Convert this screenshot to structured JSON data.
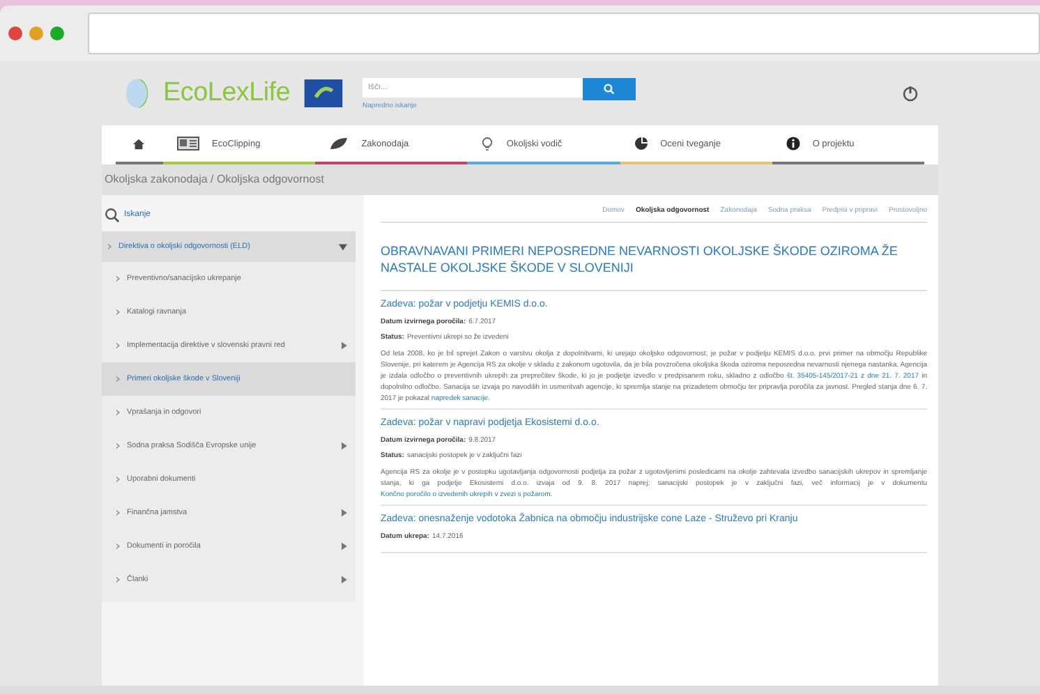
{
  "site": {
    "logo": "EcoLexLife",
    "search": {
      "placeholder": "Išči...",
      "advanced": "Napredno iskanje"
    }
  },
  "nav": [
    {
      "label": "EcoClipping",
      "color": "#a8c84a"
    },
    {
      "label": "Zakonodaja",
      "color": "#c0456a"
    },
    {
      "label": "Okoljski vodič",
      "color": "#5aa9d8"
    },
    {
      "label": "Oceni tveganje",
      "color": "#e8c07a"
    },
    {
      "label": "O projektu",
      "color": "#777777"
    }
  ],
  "breadcrumb": "Okoljska zakonodaja / Okoljska odgovornost",
  "sidebar": {
    "search_label": "Iskanje",
    "section": {
      "label": "Direktiva o okoljski odgovornosti (ELD)",
      "expanded": true
    },
    "items": [
      {
        "label": "Preventivno/sanacijsko ukrepanje",
        "selected": false,
        "has_children": false
      },
      {
        "label": "Katalogi ravnanja",
        "selected": false,
        "has_children": false
      },
      {
        "label": "Implementacija direktive v slovenski pravni red",
        "selected": false,
        "has_children": true
      },
      {
        "label": "Primeri okoljske škode v Sloveniji",
        "selected": true,
        "has_children": false
      },
      {
        "label": "Vprašanja in odgovori",
        "selected": false,
        "has_children": false
      },
      {
        "label": "Sodna praksa Sodišča Evropske unije",
        "selected": false,
        "has_children": true
      },
      {
        "label": "Uporabni dokumenti",
        "selected": false,
        "has_children": false
      },
      {
        "label": "Finančna jamstva",
        "selected": false,
        "has_children": true
      },
      {
        "label": "Dokumenti in poročila",
        "selected": false,
        "has_children": true
      },
      {
        "label": "Članki",
        "selected": false,
        "has_children": true
      }
    ]
  },
  "tabs": [
    {
      "label": "Domov",
      "selected": false
    },
    {
      "label": "Okoljska odgovornost",
      "selected": true
    },
    {
      "label": "Zakonodaja",
      "selected": false
    },
    {
      "label": "Sodna praksa",
      "selected": false
    },
    {
      "label": "Predpisi v pripravi",
      "selected": false
    },
    {
      "label": "Prostovoljno",
      "selected": false
    }
  ],
  "title": "OBRAVNAVANI PRIMERI NEPOSREDNE NEVARNOSTI OKOLJSKE ŠKODE OZIROMA ŽE NASTALE OKOLJSKE ŠKODE V SLOVENIJI",
  "cases": [
    {
      "heading": "Zadeva: požar v podjetju KEMIS d.o.o.",
      "fields": [
        {
          "label": "Datum izvirnega poročila:",
          "value": "6.7.2017"
        },
        {
          "label": "Status:",
          "value": "Preventivni ukrepi so že izvedeni"
        }
      ],
      "paragraph": [
        {
          "text": "Od leta 2008, ko je bil sprejet Zakon o varstvu okolja z dopolnitvami, ki urejajo okoljsko odgovornost, je požar v podjetju KEMIS d.o.o. prvi primer na območju Republike Slovenije, pri katerem je Agencija RS za okolje v skladu z zakonom ugotovila, da je bila povzročena okoljska škoda oziroma neposredna nevarnosti njenega nastanka. Agencija je izdala odločbo o preventivnih ukrepih za preprečitev škode, ki jo je podjetje izvedlo v predpisanem roku, skladno z odločbo ",
          "link": false
        },
        {
          "text": "št. 35405-145/2017-21 z dne 21. 7. 2017",
          "link": true
        },
        {
          "text": " in dopolnilno odločbo. Sanacija se izvaja po navodilih in usmeritvah agencije, ki spremlja stanje na prizadetem območju ter pripravlja poročila za javnost. Pregled stanja dne 6. 7. 2017 je pokazal ",
          "link": false
        },
        {
          "text": "napredek sanacije.",
          "link": true
        }
      ]
    },
    {
      "heading": "Zadeva: požar v napravi podjetja Ekosistemi d.o.o.",
      "fields": [
        {
          "label": "Datum izvirnega poročila:",
          "value": "9.8.2017"
        },
        {
          "label": "Status:",
          "value": "sanacijski postopek je v zaključni fazi"
        }
      ],
      "paragraph": [
        {
          "text": "Agencija RS za okolje je v postopku ugotavljanja odgovornosti podjetja za požar z ugotovljenimi posledicami na okolje zahtevala izvedbo sanacijskih ukrepov in spremljanje stanja, ki ga podjetje Ekosistemi d.o.o. izvaja od 9. 8. 2017 naprej; sanacijski postopek je v zaključni fazi, več informacij je v dokumentu ",
          "link": false
        },
        {
          "text": "Končno poročilo o izvedenih ukrepih v zvezi s požarom.",
          "link": true
        }
      ]
    },
    {
      "heading": "Zadeva: onesnaženje vodotoka Žabnica na območju industrijske cone Laze - Struževo pri Kranju",
      "fields": [
        {
          "label": "Datum ukrepa:",
          "value": "14.7.2016"
        }
      ]
    }
  ]
}
